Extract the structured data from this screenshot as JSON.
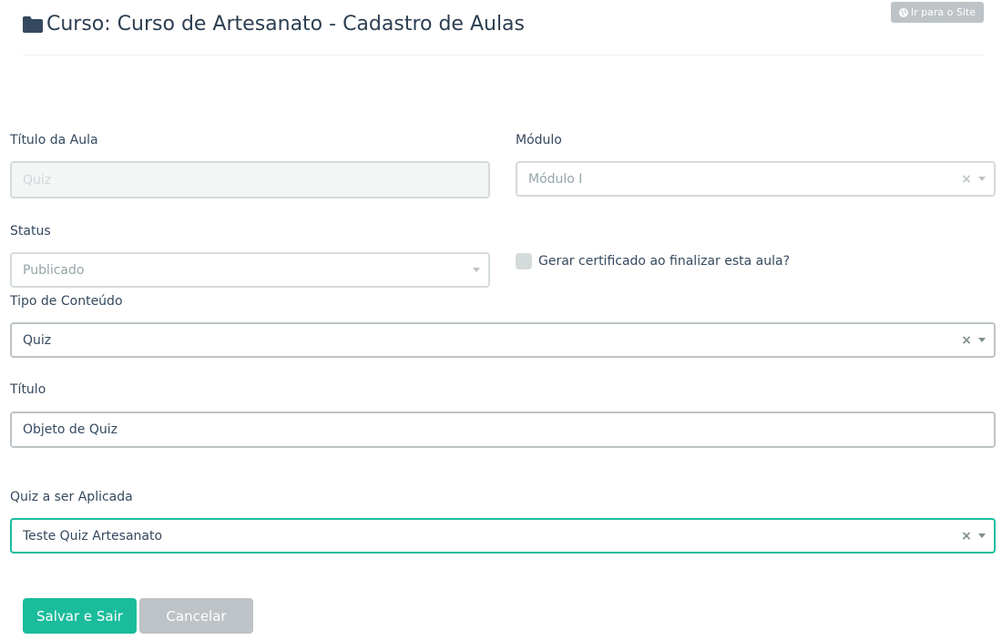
{
  "header": {
    "title": "Curso: Curso de Artesanato  - Cadastro de Aulas",
    "site_button_label": "Ir para o Site"
  },
  "form": {
    "titulo_aula": {
      "label": "Título da Aula",
      "value": "Quiz"
    },
    "modulo": {
      "label": "Módulo",
      "value": "Módulo I"
    },
    "status": {
      "label": "Status",
      "value": "Publicado"
    },
    "certificado": {
      "label": "Gerar certificado ao finalizar esta aula?",
      "checked": false
    },
    "tipo_conteudo": {
      "label": "Tipo de Conteúdo",
      "value": "Quiz"
    },
    "titulo": {
      "label": "Título",
      "value": "Objeto de Quiz"
    },
    "quiz": {
      "label": "Quiz a ser Aplicada",
      "value": "Teste Quiz Artesanato"
    }
  },
  "actions": {
    "save_label": "Salvar e Sair",
    "cancel_label": "Cancelar"
  },
  "icons": {
    "title_icon": "folder-icon",
    "site_icon": "globe-icon",
    "clear_glyph": "×"
  },
  "colors": {
    "primary": "#1abc9c",
    "secondary": "#bdc3c7",
    "text": "#34495e"
  }
}
